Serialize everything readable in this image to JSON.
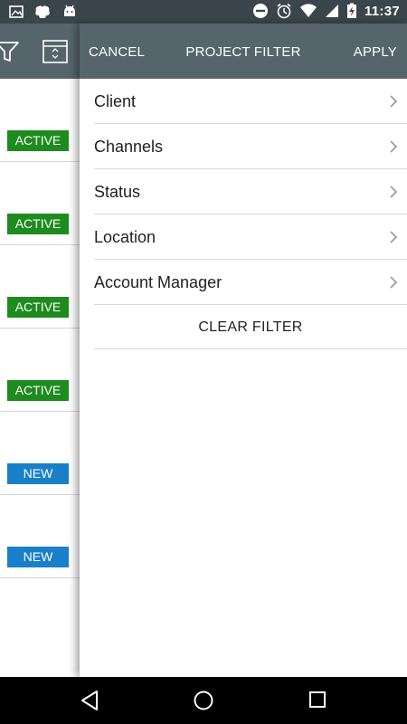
{
  "status_bar": {
    "time": "11:37",
    "left_icons": [
      "image-notification-icon",
      "brain-notification-icon",
      "android-notification-icon"
    ],
    "right_icons": [
      "do-not-disturb-icon",
      "alarm-icon",
      "wifi-icon",
      "signal-icon",
      "battery-charging-icon"
    ]
  },
  "underlying_list": {
    "toolbar_icons": [
      "filter-icon",
      "sort-icon"
    ],
    "rows": [
      {
        "status": "ACTIVE",
        "color": "#1e8b1e"
      },
      {
        "status": "ACTIVE",
        "color": "#1e8b1e"
      },
      {
        "status": "ACTIVE",
        "color": "#1e8b1e"
      },
      {
        "status": "ACTIVE",
        "color": "#1e8b1e"
      },
      {
        "status": "NEW",
        "color": "#1a7fc9"
      },
      {
        "status": "NEW",
        "color": "#1a7fc9"
      }
    ]
  },
  "drawer": {
    "header": {
      "cancel_label": "CANCEL",
      "title": "PROJECT FILTER",
      "apply_label": "APPLY",
      "background": "#56656c"
    },
    "filters": [
      {
        "label": "Client"
      },
      {
        "label": "Channels"
      },
      {
        "label": "Status"
      },
      {
        "label": "Location"
      },
      {
        "label": "Account Manager"
      }
    ],
    "clear_label": "CLEAR FILTER"
  },
  "nav_bar": {
    "buttons": [
      "back-icon",
      "home-icon",
      "recents-icon"
    ]
  }
}
